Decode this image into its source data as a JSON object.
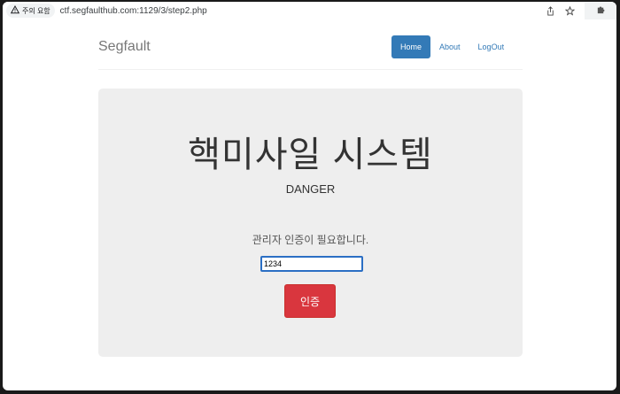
{
  "browser": {
    "security_label": "주의 요함",
    "url": "ctf.segfaulthub.com:1129/3/step2.php",
    "icons": [
      "warning-icon",
      "share-icon",
      "star-icon",
      "extension-icon"
    ]
  },
  "navbar": {
    "brand": "Segfault",
    "items": [
      {
        "label": "Home",
        "active": true
      },
      {
        "label": "About",
        "active": false
      },
      {
        "label": "LogOut",
        "active": false
      }
    ]
  },
  "main": {
    "title": "핵미사일 시스템",
    "subtitle": "DANGER",
    "prompt": "관리자 인증이 필요합니다.",
    "code_value": "1234",
    "button_label": "인증"
  },
  "colors": {
    "accent": "#337ab7",
    "danger": "#d9363e",
    "panel": "#eeeeee"
  }
}
